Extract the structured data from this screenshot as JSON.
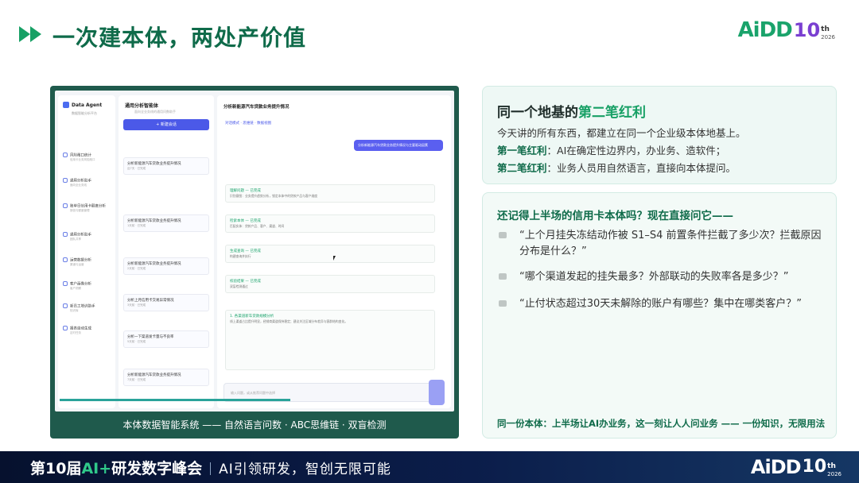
{
  "header": {
    "title": "一次建本体，两处产价值",
    "logo": {
      "main": "AiDD",
      "number": "10",
      "suffix": "th",
      "year": "2026"
    }
  },
  "screenshot": {
    "caption": "本体数据智能系统 —— 自然语言问数 · ABC思维链 · 双盲检测",
    "app": {
      "brand": "Data Agent",
      "brand_sub": "数据智能分析平台",
      "nav": [
        {
          "label": "风险敞口统计",
          "sub": "信用卡业务风险敞口"
        },
        {
          "label": "通用分析助手",
          "sub": "面向全业务线"
        },
        {
          "label": "账单日信用卡额度分析",
          "sub": "授信与额度管理"
        },
        {
          "label": "通用分析助手",
          "sub": "团队共享"
        },
        {
          "label": "运营数据分析",
          "sub": "渠道与运营"
        },
        {
          "label": "客户画像分析",
          "sub": "客户洞察"
        },
        {
          "label": "新员工培训助手",
          "sub": "知识库"
        },
        {
          "label": "报表自动生成",
          "sub": "定时任务"
        }
      ],
      "list_title": "通用分析智能体",
      "list_sub": "面向全业务线的通用问数助手",
      "new_button": "+ 新建会话",
      "list_items": [
        {
          "title": "分析新能源汽车贷款业务提升情况",
          "meta": "近7天 · 已完成"
        },
        {
          "title": "分析新能源汽车贷款业务提升情况",
          "meta": "1天前 · 已完成"
        },
        {
          "title": "分析新能源汽车贷款业务提升情况",
          "meta": "2天前 · 已完成"
        },
        {
          "title": "分析上月信用卡交易异常情况",
          "meta": "3天前 · 已完成"
        },
        {
          "title": "分析一下渠道发卡量与不良率",
          "meta": "5天前 · 已完成"
        },
        {
          "title": "分析新能源汽车贷款业务提升情况",
          "meta": "7天前 · 已完成"
        }
      ],
      "main_title": "分析新能源汽车贷款业务提升情况",
      "tabs": "对话模式  ·  思维链  ·  数据视图",
      "user_question": "分析新能源汽车贷款业务提升情况与主要驱动因素",
      "cards": [
        {
          "head": "理解问题 — 已完成",
          "body": "识别意图：业务提升趋势分析，锁定本体中的贷款产品与客户维度"
        },
        {
          "head": "检索本体 — 已完成",
          "body": "匹配实体：贷款产品、客户、渠道、时间"
        },
        {
          "head": "生成查询 — 已完成",
          "body": "构建查询并执行"
        },
        {
          "head": "校验结果 — 已完成",
          "body": "双盲检测通过"
        },
        {
          "head": "1. 各渠道新车贷款规模分析",
          "body": "线上渠道占比提升明显，经销商渠道保持稳定；建议关注区域分布差异与客群结构变化。"
        }
      ],
      "input_placeholder": "输入问题，或从推荐问题中选择"
    }
  },
  "panel1": {
    "title_prefix": "同一个地基的",
    "title_highlight": "第二笔红利",
    "line1": "今天讲的所有东西，都建立在同一个企业级本体地基上。",
    "line2_label": "第一笔红利",
    "line2_text": "：AI在确定性边界内，办业务、造软件；",
    "line3_label": "第二笔红利",
    "line3_text": "：业务人员用自然语言，直接向本体提问。"
  },
  "panel2": {
    "title": "还记得上半场的信用卡本体吗？现在直接问它——",
    "questions": [
      "“上个月挂失冻结动作被 S1–S4 前置条件拦截了多少次？拦截原因分布是什么？”",
      "“哪个渠道发起的挂失最多？外部联动的失败率各是多少？”",
      "“止付状态超过30天未解除的账户有哪些？集中在哪类客户？”"
    ],
    "footer": "同一份本体：上半场让AI办业务，这一刻让人人问业务 —— 一份知识，无限用法"
  },
  "footer": {
    "event_prefix": "第10届",
    "event_ai": "AI+",
    "event_suffix": "研发数字峰会",
    "slogan": "AI引领研发，智创无限可能",
    "logo": {
      "main": "AiDD",
      "number": "10",
      "suffix": "th",
      "year": "2026"
    }
  },
  "colors": {
    "brand_green": "#17a065",
    "dark_green": "#0f6b4a",
    "accent_purple": "#7a3fd1",
    "footer_navy": "#06112e"
  }
}
